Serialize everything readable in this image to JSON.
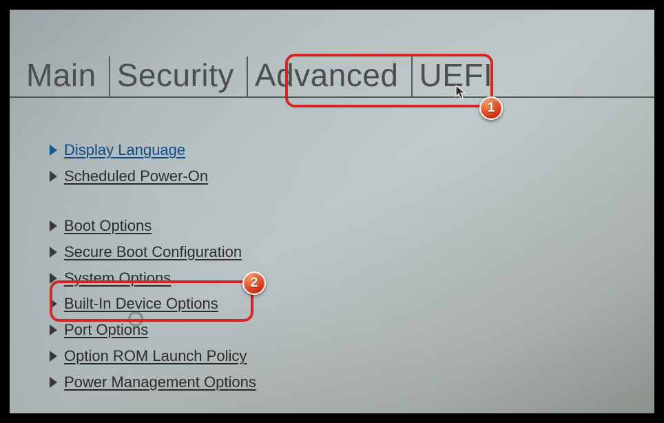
{
  "tabs": {
    "main": "Main",
    "security": "Security",
    "advanced": "Advanced",
    "uefi": "UEFI "
  },
  "menu": {
    "group1": [
      {
        "label": "Display Language",
        "active": true
      },
      {
        "label": "Scheduled Power-On",
        "active": false
      }
    ],
    "group2": [
      {
        "label": "Boot Options",
        "active": false
      },
      {
        "label": "Secure Boot Configuration",
        "active": false
      },
      {
        "label": "System Options",
        "active": false
      },
      {
        "label": "Built-In Device Options",
        "active": false
      },
      {
        "label": "Port Options",
        "active": false
      },
      {
        "label": "Option ROM Launch Policy",
        "active": false
      },
      {
        "label": "Power Management Options",
        "active": false
      }
    ]
  },
  "annotations": {
    "badge1": "1",
    "badge2": "2"
  }
}
